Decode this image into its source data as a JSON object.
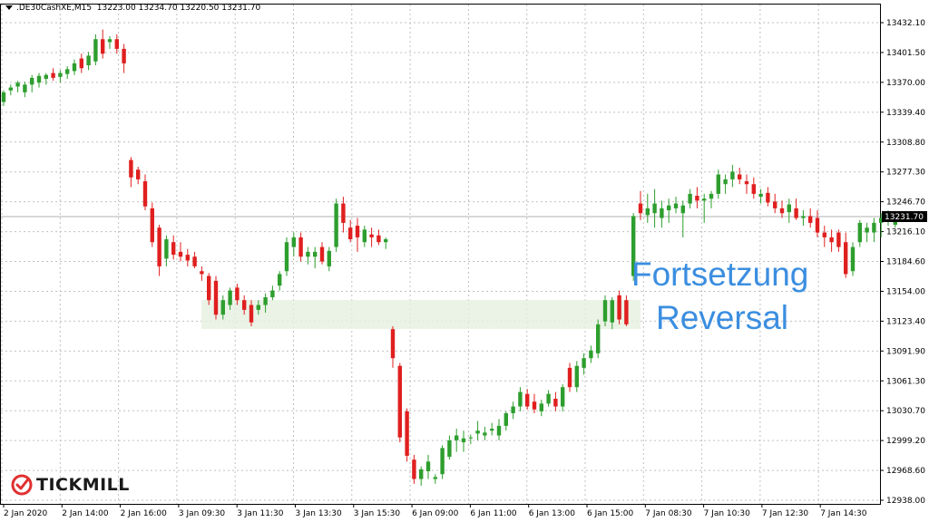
{
  "header": {
    "symbol": ".DE30CashXE,M15",
    "open": "13223.00",
    "high": "13234.70",
    "low": "13220.50",
    "close": "13231.70"
  },
  "logo": {
    "text": "TICKMILL",
    "color": "#e03030"
  },
  "annotations": {
    "line1": "Fortsetzung",
    "line2": "Reversal",
    "color": "#3b8ee0"
  },
  "chart_data": {
    "type": "candlestick",
    "up_color": "#2e9e2e",
    "down_color": "#e01f1f",
    "current_price": "13231.70",
    "ylim": [
      12938.0,
      13432.1
    ],
    "y_ticks": [
      "13432.10",
      "13401.50",
      "13370.00",
      "13339.40",
      "13308.80",
      "13277.30",
      "13246.70",
      "13216.10",
      "13184.60",
      "13154.00",
      "13123.40",
      "13091.90",
      "13061.30",
      "13030.70",
      "12999.20",
      "12968.60",
      "12938.00"
    ],
    "x_ticks": [
      "2 Jan 2020",
      "2 Jan 14:00",
      "2 Jan 16:00",
      "3 Jan 09:30",
      "3 Jan 11:30",
      "3 Jan 13:30",
      "3 Jan 15:30",
      "6 Jan 09:00",
      "6 Jan 11:00",
      "6 Jan 13:00",
      "6 Jan 15:00",
      "7 Jan 08:30",
      "7 Jan 10:30",
      "7 Jan 12:30",
      "7 Jan 14:30"
    ],
    "highlight_zone": {
      "from": 13123,
      "to": 13150,
      "color": "#e6f0e0"
    },
    "candles": [
      [
        13350,
        13362,
        13346,
        13360
      ],
      [
        13362,
        13368,
        13357,
        13365
      ],
      [
        13366,
        13372,
        13360,
        13370
      ],
      [
        13360,
        13371,
        13355,
        13368
      ],
      [
        13368,
        13378,
        13360,
        13375
      ],
      [
        13370,
        13380,
        13365,
        13377
      ],
      [
        13374,
        13380,
        13368,
        13378
      ],
      [
        13380,
        13385,
        13372,
        13375
      ],
      [
        13376,
        13383,
        13370,
        13380
      ],
      [
        13379,
        13387,
        13374,
        13384
      ],
      [
        13382,
        13394,
        13378,
        13390
      ],
      [
        13395,
        13400,
        13380,
        13385
      ],
      [
        13388,
        13402,
        13383,
        13398
      ],
      [
        13392,
        13420,
        13388,
        13415
      ],
      [
        13415,
        13425,
        13395,
        13400
      ],
      [
        13412,
        13418,
        13405,
        13415
      ],
      [
        13415,
        13420,
        13400,
        13405
      ],
      [
        13405,
        13410,
        13380,
        13390
      ],
      [
        13290,
        13293,
        13262,
        13272
      ],
      [
        13280,
        13283,
        13265,
        13270
      ],
      [
        13268,
        13275,
        13238,
        13242
      ],
      [
        13240,
        13246,
        13200,
        13205
      ],
      [
        13220,
        13223,
        13170,
        13180
      ],
      [
        13188,
        13212,
        13180,
        13208
      ],
      [
        13205,
        13212,
        13187,
        13192
      ],
      [
        13195,
        13205,
        13185,
        13190
      ],
      [
        13192,
        13198,
        13180,
        13186
      ],
      [
        13190,
        13195,
        13178,
        13180
      ],
      [
        13175,
        13180,
        13165,
        13172
      ],
      [
        13170,
        13173,
        13140,
        13145
      ],
      [
        13165,
        13170,
        13125,
        13130
      ],
      [
        13130,
        13150,
        13125,
        13145
      ],
      [
        13140,
        13158,
        13135,
        13155
      ],
      [
        13158,
        13162,
        13140,
        13145
      ],
      [
        13145,
        13150,
        13130,
        13135
      ],
      [
        13140,
        13145,
        13118,
        13122
      ],
      [
        13135,
        13145,
        13130,
        13140
      ],
      [
        13140,
        13152,
        13132,
        13148
      ],
      [
        13148,
        13160,
        13145,
        13155
      ],
      [
        13160,
        13175,
        13155,
        13172
      ],
      [
        13175,
        13210,
        13170,
        13205
      ],
      [
        13200,
        13215,
        13190,
        13210
      ],
      [
        13210,
        13215,
        13185,
        13190
      ],
      [
        13190,
        13200,
        13182,
        13195
      ],
      [
        13190,
        13200,
        13178,
        13195
      ],
      [
        13200,
        13205,
        13182,
        13185
      ],
      [
        13180,
        13200,
        13175,
        13196
      ],
      [
        13200,
        13250,
        13195,
        13245
      ],
      [
        13245,
        13252,
        13215,
        13225
      ],
      [
        13220,
        13228,
        13205,
        13208
      ],
      [
        13222,
        13230,
        13195,
        13210
      ],
      [
        13205,
        13222,
        13200,
        13218
      ],
      [
        13213,
        13220,
        13200,
        13210
      ],
      [
        13212,
        13218,
        13202,
        13205
      ],
      [
        13205,
        13210,
        13198,
        13208
      ],
      [
        13115,
        13118,
        13075,
        13085
      ],
      [
        13077,
        13080,
        12998,
        13003
      ],
      [
        13030,
        13033,
        12978,
        12984
      ],
      [
        12980,
        12985,
        12955,
        12960
      ],
      [
        12960,
        12973,
        12953,
        12970
      ],
      [
        12968,
        12985,
        12960,
        12978
      ],
      [
        12960,
        12965,
        12955,
        12962
      ],
      [
        12965,
        12995,
        12960,
        12992
      ],
      [
        12983,
        13005,
        12980,
        13000
      ],
      [
        13000,
        13012,
        12988,
        13005
      ],
      [
        12998,
        13010,
        12988,
        13002
      ],
      [
        13002,
        13006,
        12996,
        13003
      ],
      [
        13007,
        13020,
        13000,
        13010
      ],
      [
        13005,
        13014,
        13000,
        13008
      ],
      [
        13010,
        13018,
        13005,
        13012
      ],
      [
        13005,
        13022,
        13000,
        13015
      ],
      [
        13015,
        13030,
        13010,
        13028
      ],
      [
        13028,
        13040,
        13022,
        13035
      ],
      [
        13035,
        13055,
        13030,
        13050
      ],
      [
        13048,
        13053,
        13032,
        13035
      ],
      [
        13040,
        13048,
        13028,
        13032
      ],
      [
        13030,
        13042,
        13025,
        13038
      ],
      [
        13038,
        13052,
        13035,
        13048
      ],
      [
        13043,
        13050,
        13030,
        13035
      ],
      [
        13035,
        13058,
        13030,
        13055
      ],
      [
        13075,
        13080,
        13050,
        13055
      ],
      [
        13055,
        13082,
        13050,
        13077
      ],
      [
        13075,
        13090,
        13068,
        13085
      ],
      [
        13085,
        13098,
        13080,
        13093
      ],
      [
        13090,
        13125,
        13085,
        13120
      ],
      [
        13123,
        13150,
        13118,
        13145
      ],
      [
        13122,
        13148,
        13115,
        13145
      ],
      [
        13150,
        13155,
        13120,
        13125
      ],
      [
        13145,
        13150,
        13118,
        13120
      ],
      [
        13170,
        13235,
        13165,
        13232
      ],
      [
        13245,
        13258,
        13228,
        13235
      ],
      [
        13233,
        13255,
        13225,
        13240
      ],
      [
        13235,
        13260,
        13220,
        13245
      ],
      [
        13230,
        13248,
        13220,
        13240
      ],
      [
        13238,
        13250,
        13225,
        13243
      ],
      [
        13240,
        13252,
        13235,
        13245
      ],
      [
        13235,
        13248,
        13210,
        13243
      ],
      [
        13245,
        13260,
        13240,
        13255
      ],
      [
        13253,
        13262,
        13240,
        13248
      ],
      [
        13248,
        13255,
        13225,
        13250
      ],
      [
        13250,
        13258,
        13240,
        13255
      ],
      [
        13255,
        13280,
        13250,
        13275
      ],
      [
        13265,
        13275,
        13255,
        13270
      ],
      [
        13270,
        13285,
        13262,
        13278
      ],
      [
        13275,
        13282,
        13265,
        13270
      ],
      [
        13268,
        13275,
        13255,
        13265
      ],
      [
        13265,
        13272,
        13250,
        13255
      ],
      [
        13252,
        13260,
        13245,
        13255
      ],
      [
        13256,
        13262,
        13242,
        13246
      ],
      [
        13247,
        13255,
        13235,
        13240
      ],
      [
        13240,
        13248,
        13230,
        13235
      ],
      [
        13236,
        13250,
        13225,
        13244
      ],
      [
        13240,
        13250,
        13228,
        13230
      ],
      [
        13230,
        13238,
        13222,
        13232
      ],
      [
        13232,
        13240,
        13220,
        13225
      ],
      [
        13230,
        13238,
        13210,
        13215
      ],
      [
        13215,
        13222,
        13200,
        13210
      ],
      [
        13210,
        13218,
        13195,
        13205
      ],
      [
        13215,
        13218,
        13195,
        13200
      ],
      [
        13205,
        13215,
        13168,
        13172
      ],
      [
        13175,
        13205,
        13170,
        13200
      ],
      [
        13205,
        13228,
        13200,
        13225
      ],
      [
        13215,
        13225,
        13205,
        13220
      ],
      [
        13215,
        13230,
        13205,
        13225
      ],
      [
        13225,
        13235,
        13210,
        13230
      ],
      [
        13228,
        13238,
        13222,
        13232
      ],
      [
        13223,
        13235,
        13220,
        13232
      ]
    ]
  }
}
